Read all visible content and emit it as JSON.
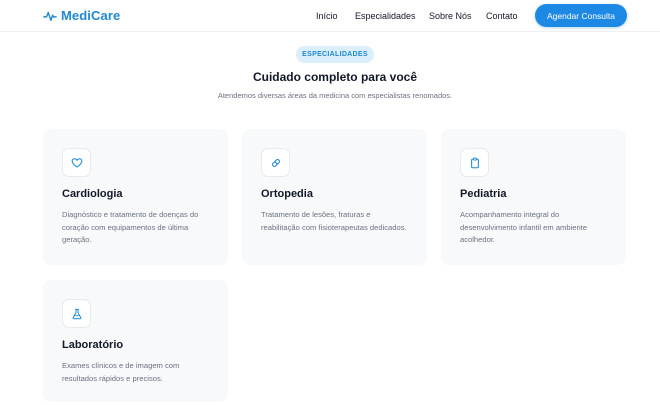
{
  "brand": {
    "name": "MediCare",
    "icon": "heartbeat-pulse-icon",
    "color": "#1e88d2"
  },
  "nav": {
    "items": [
      {
        "label": "Início"
      },
      {
        "label": "Especialidades"
      },
      {
        "label": "Sobre Nós"
      },
      {
        "label": "Contato"
      }
    ],
    "cta_label": "Agendar Consulta",
    "cta_color": "#1e88e5"
  },
  "section": {
    "badge": "ESPECIALIDADES",
    "title": "Cuidado completo para você",
    "subtitle": "Atendemos diversas áreas da medicina com especialistas renomados."
  },
  "cards": [
    {
      "icon": "heart-icon",
      "title": "Cardiologia",
      "description": "Diagnóstico e tratamento de doenças do coração com equipamentos de última geração."
    },
    {
      "icon": "pill-icon",
      "title": "Ortopedia",
      "description": "Tratamento de lesões, fraturas e reabilitação com fisioterapeutas dedicados."
    },
    {
      "icon": "clipboard-icon",
      "title": "Pediatria",
      "description": "Acompanhamento integral do desenvolvimento infantil em ambiente acolhedor."
    },
    {
      "icon": "flask-icon",
      "title": "Laboratório",
      "description": "Exames clínicos e de imagem com resultados rápidos e precisos."
    }
  ]
}
